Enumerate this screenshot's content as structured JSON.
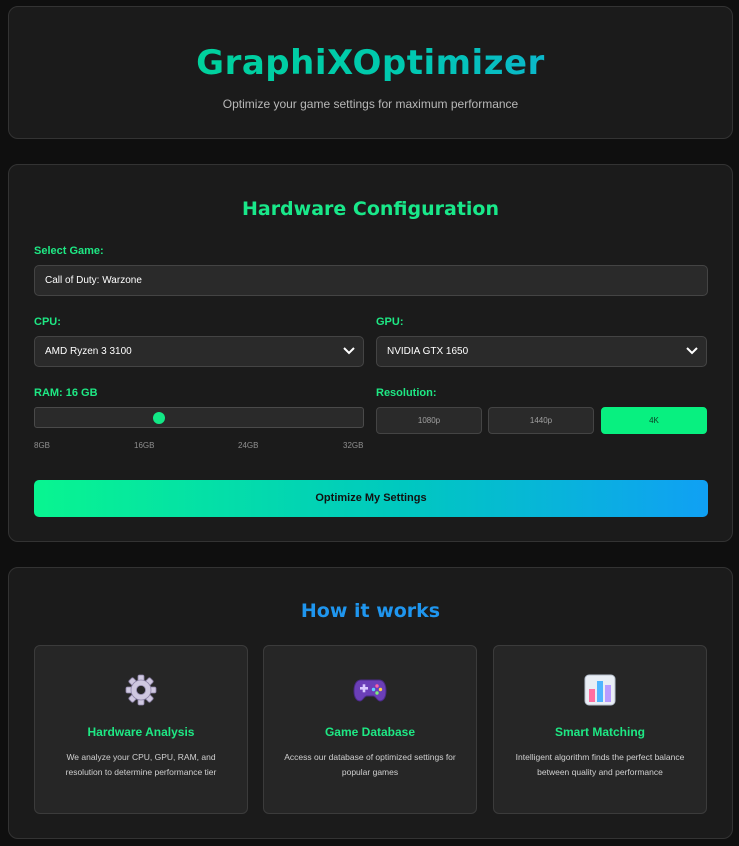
{
  "header": {
    "title": "GraphiXOptimizer",
    "subtitle": "Optimize your game settings for maximum performance"
  },
  "hardware": {
    "title": "Hardware Configuration",
    "game_label": "Select Game:",
    "game_value": "Call of Duty: Warzone",
    "cpu_label": "CPU:",
    "cpu_value": "AMD Ryzen 3 3100",
    "gpu_label": "GPU:",
    "gpu_value": "NVIDIA GTX 1650",
    "ram_label": "RAM: 16 GB",
    "ram_value_gb": 16,
    "ram_min_gb": 8,
    "ram_max_gb": 32,
    "ram_ticks": [
      "8GB",
      "16GB",
      "24GB",
      "32GB"
    ],
    "resolution_label": "Resolution:",
    "resolutions": [
      "1080p",
      "1440p",
      "4K"
    ],
    "selected_resolution": "4K",
    "optimize_label": "Optimize My Settings"
  },
  "how": {
    "title": "How it works",
    "features": [
      {
        "icon": "gear-icon",
        "title": "Hardware Analysis",
        "desc": "We analyze your CPU, GPU, RAM, and resolution to determine performance tier"
      },
      {
        "icon": "gamepad-icon",
        "title": "Game Database",
        "desc": "Access our database of optimized settings for popular games"
      },
      {
        "icon": "bar-chart-icon",
        "title": "Smart Matching",
        "desc": "Intelligent algorithm finds the perfect balance between quality and performance"
      }
    ]
  },
  "colors": {
    "accent_green": "#1ee884",
    "accent_blue": "#1f96ef",
    "background": "#0f0f0f",
    "card": "#1b1b1b"
  }
}
